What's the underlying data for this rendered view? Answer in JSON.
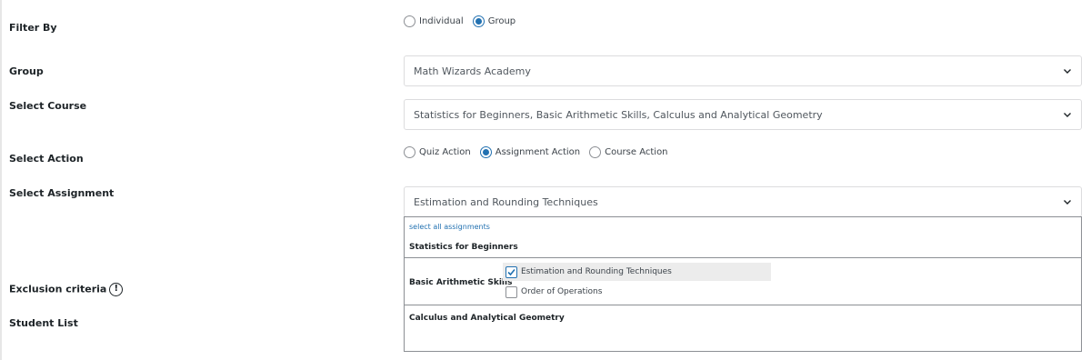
{
  "filter_by": {
    "label": "Filter By",
    "options": [
      "Individual",
      "Group"
    ],
    "selected": "Group"
  },
  "group": {
    "label": "Group",
    "value": "Math Wizards Academy"
  },
  "select_course": {
    "label": "Select Course",
    "value": "Statistics for Beginners, Basic Arithmetic Skills, Calculus and Analytical Geometry"
  },
  "select_action": {
    "label": "Select Action",
    "options": [
      "Quiz Action",
      "Assignment Action",
      "Course Action"
    ],
    "selected": "Assignment Action"
  },
  "select_assignment": {
    "label": "Select Assignment",
    "value": "Estimation and Rounding Techniques",
    "dropdown": {
      "select_all_link": "select all assignments",
      "groups": [
        {
          "title": "Statistics for Beginners",
          "items": []
        },
        {
          "title": "Basic Arithmetic Skills",
          "items": [
            {
              "label": "Estimation and Rounding Techniques",
              "checked": true
            },
            {
              "label": "Order of Operations",
              "checked": false
            }
          ]
        },
        {
          "title": "Calculus and Analytical Geometry",
          "items": []
        }
      ]
    }
  },
  "exclusion_criteria": {
    "label": "Exclusion criteria",
    "icon": "info-icon",
    "icon_glyph": "!"
  },
  "student_list": {
    "label": "Student List"
  },
  "colors": {
    "accent": "#2271b1",
    "border": "#dcdcde",
    "highlight": "#ececec"
  }
}
